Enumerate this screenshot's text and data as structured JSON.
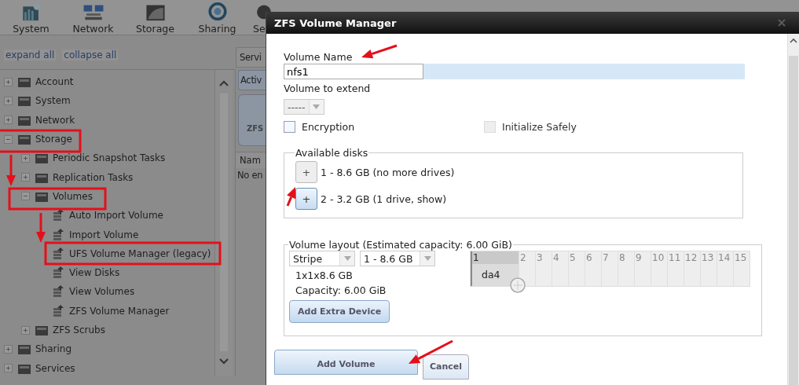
{
  "toolbar": {
    "items": [
      {
        "label": "System"
      },
      {
        "label": "Network"
      },
      {
        "label": "Storage"
      },
      {
        "label": "Sharing"
      },
      {
        "label": "Se"
      }
    ]
  },
  "tree_links": [
    "expand all",
    "collapse all"
  ],
  "tree": [
    {
      "label": "Account",
      "expanded": false
    },
    {
      "label": "System",
      "expanded": false
    },
    {
      "label": "Network",
      "expanded": false
    },
    {
      "label": "Storage",
      "expanded": true,
      "children": [
        {
          "label": "Periodic Snapshot Tasks",
          "expanded": false
        },
        {
          "label": "Replication Tasks",
          "expanded": false
        },
        {
          "label": "Volumes",
          "expanded": true,
          "children": [
            {
              "label": "Auto Import Volume"
            },
            {
              "label": "Import Volume"
            },
            {
              "label": "UFS Volume Manager (legacy)"
            },
            {
              "label": "View Disks"
            },
            {
              "label": "View Volumes"
            },
            {
              "label": "ZFS Volume Manager"
            }
          ]
        },
        {
          "label": "ZFS Scrubs",
          "expanded": false
        }
      ]
    },
    {
      "label": "Sharing",
      "expanded": false
    },
    {
      "label": "Services",
      "expanded": false
    }
  ],
  "middle_panel": {
    "tab": "Servi",
    "button": "Activ",
    "card": "ZFS",
    "column_header": "Nam",
    "empty_text": "No en"
  },
  "dialog": {
    "title": "ZFS Volume Manager",
    "volume_name": {
      "label": "Volume Name",
      "value": "nfs1"
    },
    "volume_to_extend": {
      "label": "Volume to extend",
      "value": "-----",
      "disabled": true
    },
    "checkboxes": [
      {
        "label": "Encryption",
        "checked": false,
        "disabled": false
      },
      {
        "label": "Initialize Safely",
        "checked": false,
        "disabled": true
      }
    ],
    "available_disks": {
      "legend": "Available disks",
      "rows": [
        {
          "button": "+",
          "text": "1 - 8.6 GB (no more drives)",
          "disabled": true
        },
        {
          "button": "+",
          "text": "2 - 3.2 GB (1 drive, show)",
          "disabled": false
        }
      ]
    },
    "volume_layout": {
      "legend": "Volume layout (Estimated capacity: 6.00 GiB)",
      "layout": "Stripe",
      "disk": "1 - 8.6 GB",
      "summary": "1x1x8.6 GB",
      "capacity": "Capacity: 6.00 GiB",
      "extra_button": "Add Extra Device",
      "columns": [
        {
          "label": "1",
          "selected": true
        },
        {
          "label": "2",
          "selected": false
        },
        {
          "label": "3",
          "selected": false
        },
        {
          "label": "4",
          "selected": false
        },
        {
          "label": "5",
          "selected": false
        },
        {
          "label": "6",
          "selected": false
        },
        {
          "label": "7",
          "selected": false
        },
        {
          "label": "8",
          "selected": false
        },
        {
          "label": "9",
          "selected": false
        },
        {
          "label": "10",
          "selected": false
        },
        {
          "label": "11",
          "selected": false
        },
        {
          "label": "12",
          "selected": false
        },
        {
          "label": "13",
          "selected": false
        },
        {
          "label": "14",
          "selected": false
        },
        {
          "label": "15",
          "selected": false
        }
      ],
      "cell": "da4"
    },
    "buttons": [
      "Add Volume",
      "Cancel"
    ]
  }
}
